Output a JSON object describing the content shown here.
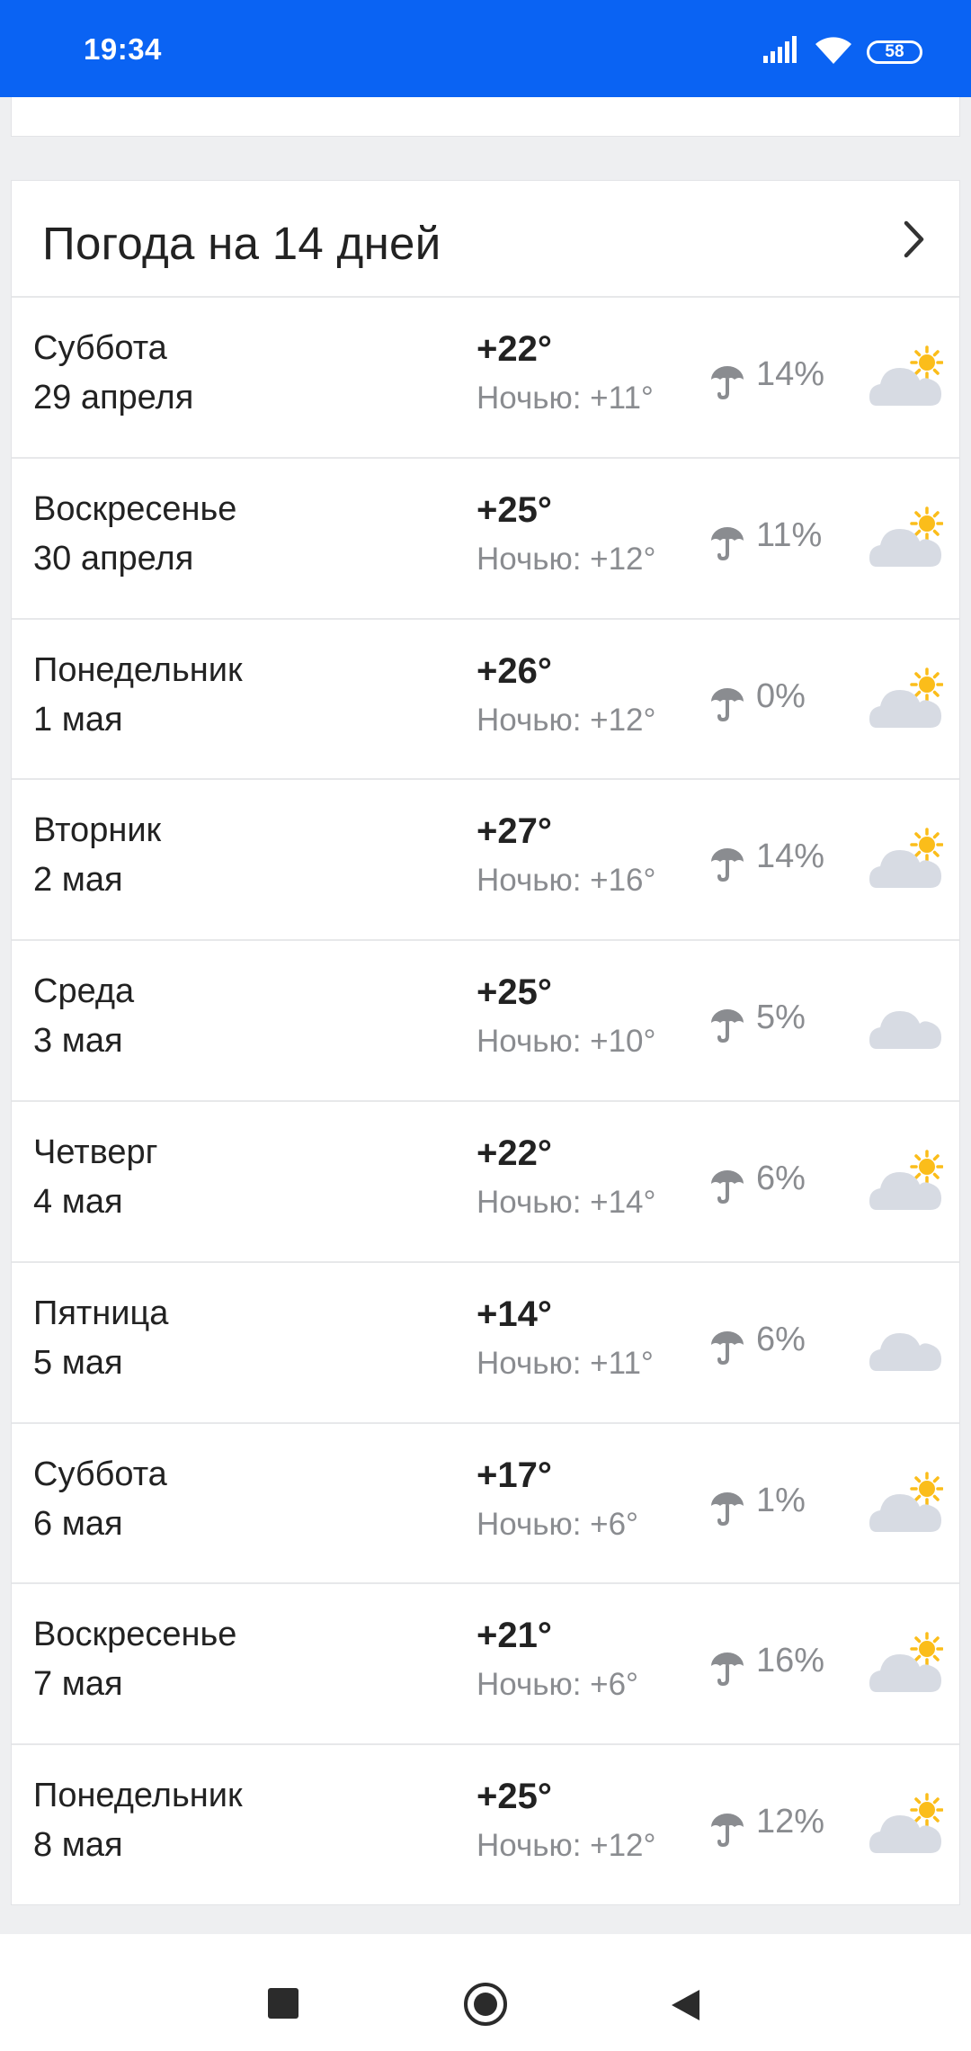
{
  "status_bar": {
    "time": "19:34",
    "battery": "58"
  },
  "forecast": {
    "title": "Погода на 14 дней",
    "days": [
      {
        "name": "Суббота",
        "date": "29 апреля",
        "temp_day": "+22°",
        "temp_night": "Ночью: +11°",
        "precip": "14%",
        "icon": "partly-cloudy-icon"
      },
      {
        "name": "Воскресенье",
        "date": "30 апреля",
        "temp_day": "+25°",
        "temp_night": "Ночью: +12°",
        "precip": "11%",
        "icon": "partly-cloudy-icon"
      },
      {
        "name": "Понедельник",
        "date": "1 мая",
        "temp_day": "+26°",
        "temp_night": "Ночью: +12°",
        "precip": "0%",
        "icon": "partly-cloudy-icon"
      },
      {
        "name": "Вторник",
        "date": "2 мая",
        "temp_day": "+27°",
        "temp_night": "Ночью: +16°",
        "precip": "14%",
        "icon": "partly-cloudy-icon"
      },
      {
        "name": "Среда",
        "date": "3 мая",
        "temp_day": "+25°",
        "temp_night": "Ночью: +10°",
        "precip": "5%",
        "icon": "cloudy-icon"
      },
      {
        "name": "Четверг",
        "date": "4 мая",
        "temp_day": "+22°",
        "temp_night": "Ночью: +14°",
        "precip": "6%",
        "icon": "partly-cloudy-icon"
      },
      {
        "name": "Пятница",
        "date": "5 мая",
        "temp_day": "+14°",
        "temp_night": "Ночью: +11°",
        "precip": "6%",
        "icon": "cloudy-icon"
      },
      {
        "name": "Суббота",
        "date": "6 мая",
        "temp_day": "+17°",
        "temp_night": "Ночью: +6°",
        "precip": "1%",
        "icon": "partly-cloudy-icon"
      },
      {
        "name": "Воскресенье",
        "date": "7 мая",
        "temp_day": "+21°",
        "temp_night": "Ночью: +6°",
        "precip": "16%",
        "icon": "partly-cloudy-icon"
      },
      {
        "name": "Понедельник",
        "date": "8 мая",
        "temp_day": "+25°",
        "temp_night": "Ночью: +12°",
        "precip": "12%",
        "icon": "partly-cloudy-icon"
      }
    ]
  },
  "colors": {
    "status_bar": "#0a63f3",
    "text_primary": "#222222",
    "text_secondary": "#8a8c90",
    "cloud": "#d7dbe3",
    "sun": "#fbbd1a"
  }
}
